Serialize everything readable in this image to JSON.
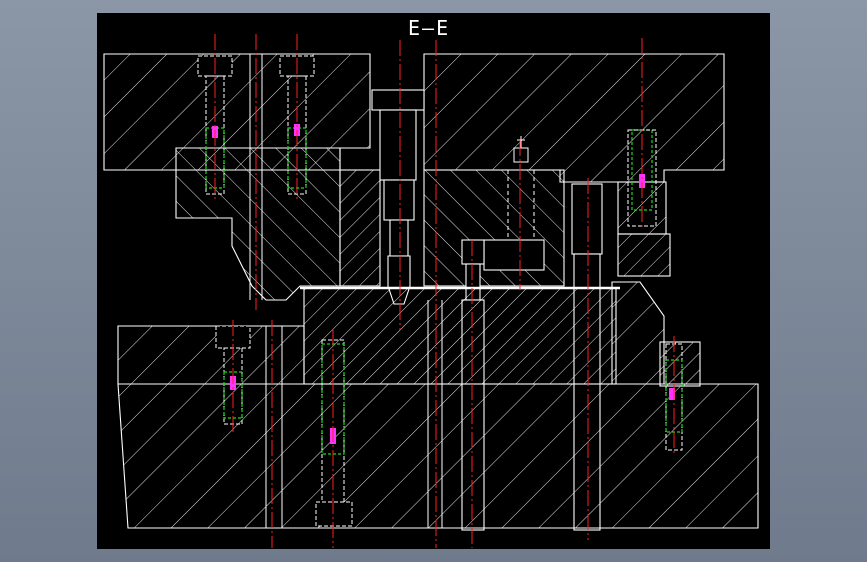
{
  "drawing": {
    "section_title": "E—E",
    "colors": {
      "background": "#000000",
      "outline": "#ffffff",
      "centerline": "#ff2020",
      "hidden": "#ffffff",
      "screw_thread": "#19d919",
      "dimension": "#ff33ff",
      "window": "#7e8a9b"
    }
  }
}
